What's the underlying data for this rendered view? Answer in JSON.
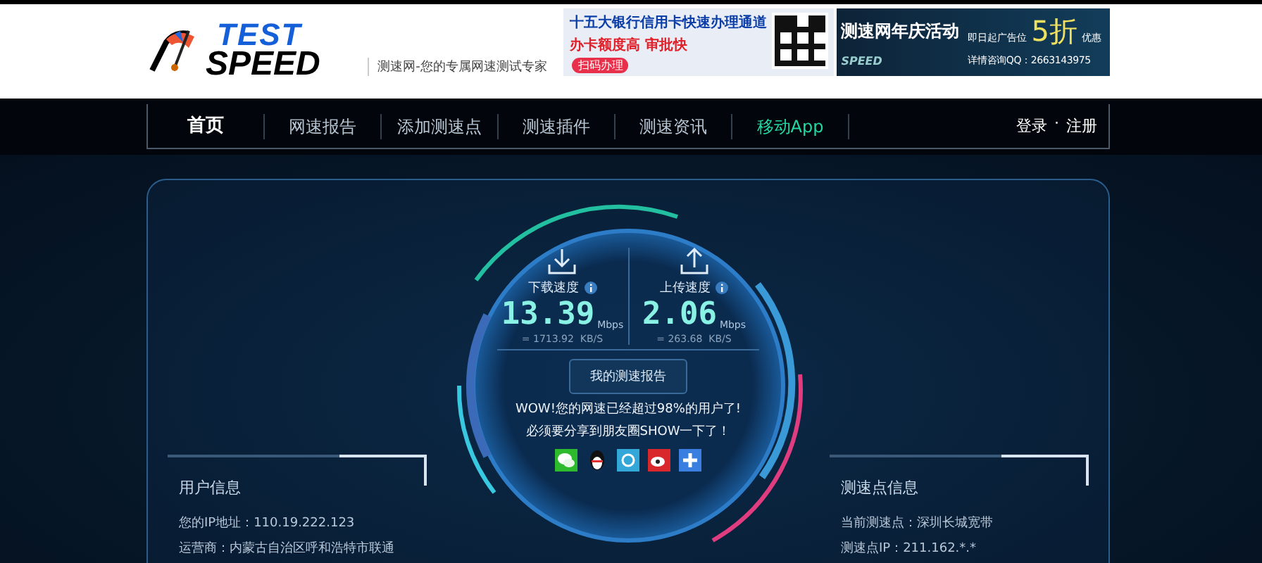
{
  "header": {
    "logo": {
      "top": "TEST",
      "bottom": "SPEED"
    },
    "slogan": "测速网-您的专属网速测试专家",
    "ads": [
      {
        "kind": "bank",
        "title": "十五大银行信用卡快速办理通道",
        "subtitle": "办卡额度高 审批快",
        "action": "扫码办理"
      },
      {
        "kind": "promo",
        "title": "测速网年庆活动",
        "logo": "SPEED",
        "note": "即日起广告位",
        "discount": "5折",
        "discount_note": "优惠",
        "contact": "详情咨询QQ：2663143975"
      }
    ]
  },
  "nav": {
    "items": [
      {
        "label": "首页",
        "selected": true,
        "highlighted": false
      },
      {
        "label": "网速报告",
        "selected": false,
        "highlighted": false
      },
      {
        "label": "添加测速点",
        "selected": false,
        "highlighted": false
      },
      {
        "label": "测速插件",
        "selected": false,
        "highlighted": false
      },
      {
        "label": "测速资讯",
        "selected": false,
        "highlighted": false
      },
      {
        "label": "移动App",
        "selected": false,
        "highlighted": true
      }
    ],
    "auth": {
      "login": "登录",
      "separator": "·",
      "register": "注册"
    }
  },
  "gauge": {
    "speeds": [
      {
        "kind": "download",
        "label": "下载速度",
        "value": "13.39",
        "unit": "Mbps",
        "converted": "= 1713.92  KB/S"
      },
      {
        "kind": "upload",
        "label": "上传速度",
        "value": "2.06",
        "unit": "Mbps",
        "converted": "= 263.68  KB/S"
      }
    ],
    "report_button": "我的测速报告",
    "messages": [
      "WOW!您的网速已经超过98%的用户了!",
      "必须要分享到朋友圈SHOW一下了！"
    ]
  },
  "user_info": {
    "title": "用户信息",
    "lines": [
      "您的IP地址：110.19.222.123",
      "运营商：内蒙古自治区呼和浩特市联通"
    ]
  },
  "server_info": {
    "title": "测速点信息",
    "lines": [
      "当前测速点：深圳长城宽带",
      "测速点IP：211.162.*.*"
    ]
  }
}
